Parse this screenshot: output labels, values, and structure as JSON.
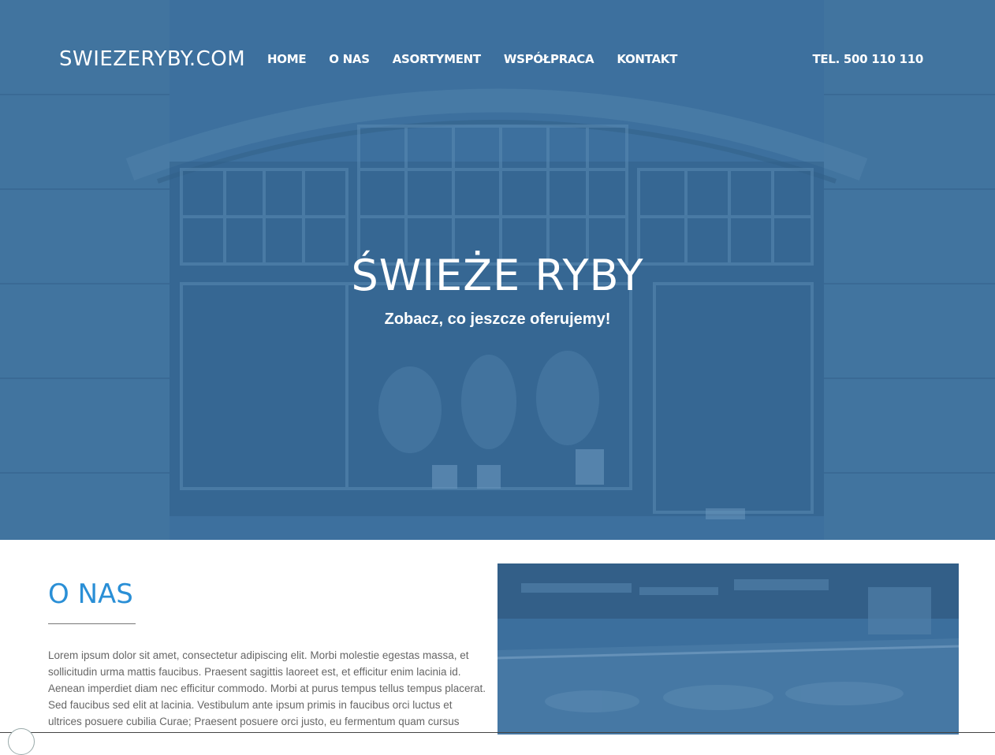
{
  "brand": "SWIEZERYBY.COM",
  "nav": {
    "items": [
      "HOME",
      "O NAS",
      "ASORTYMENT",
      "WSPÓŁPRACA",
      "KONTAKT"
    ],
    "phone": "TEL. 500 110 110"
  },
  "hero": {
    "title": "ŚWIEŻE RYBY",
    "subtitle": "Zobacz, co jeszcze oferujemy!",
    "overlay_color": "#3a6e9c"
  },
  "about": {
    "title": "O NAS",
    "text": "Lorem ipsum dolor sit amet, consectetur adipiscing elit. Morbi molestie egestas massa, et sollicitudin urma mattis faucibus. Praesent sagittis laoreet est, et efficitur enim lacinia id. Aenean imperdiet diam nec efficitur commodo. Morbi at purus tempus tellus tempus placerat. Sed faucibus sed elit at lacinia. Vestibulum ante ipsum primis in faucibus orci luctus et ultrices posuere cubilia Curae; Praesent posuere orci justo, eu fermentum quam cursus",
    "title_color": "#2a8fd6"
  }
}
